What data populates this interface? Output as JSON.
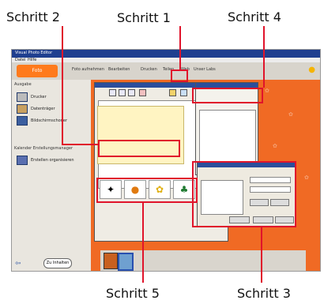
{
  "steps": {
    "s1": "Schritt 1",
    "s2": "Schritt 2",
    "s3": "Schritt 3",
    "s4": "Schritt 4",
    "s5": "Schritt 5"
  },
  "colors": {
    "callout": "#e0142b",
    "accent": "#ff7a1c",
    "title": "#1f3f8f"
  },
  "window": {
    "title": "Visual Photo Editor",
    "menu": [
      "Datei",
      "Hilfe"
    ],
    "tab": "Foto",
    "toolbar": [
      "Foto aufnehmen",
      "Bearbeiten",
      "Drucken",
      "Teilen",
      "Web",
      "Unser Labs"
    ]
  },
  "sidebar": {
    "section1": "Ausgabe",
    "items": [
      "Drucker",
      "Datenträger",
      "Bildschirmschoner"
    ],
    "section2": "Kalender Erstellungsmanager",
    "item4": "Erstellen organisieren",
    "more_button": "Zu Inhalten"
  }
}
